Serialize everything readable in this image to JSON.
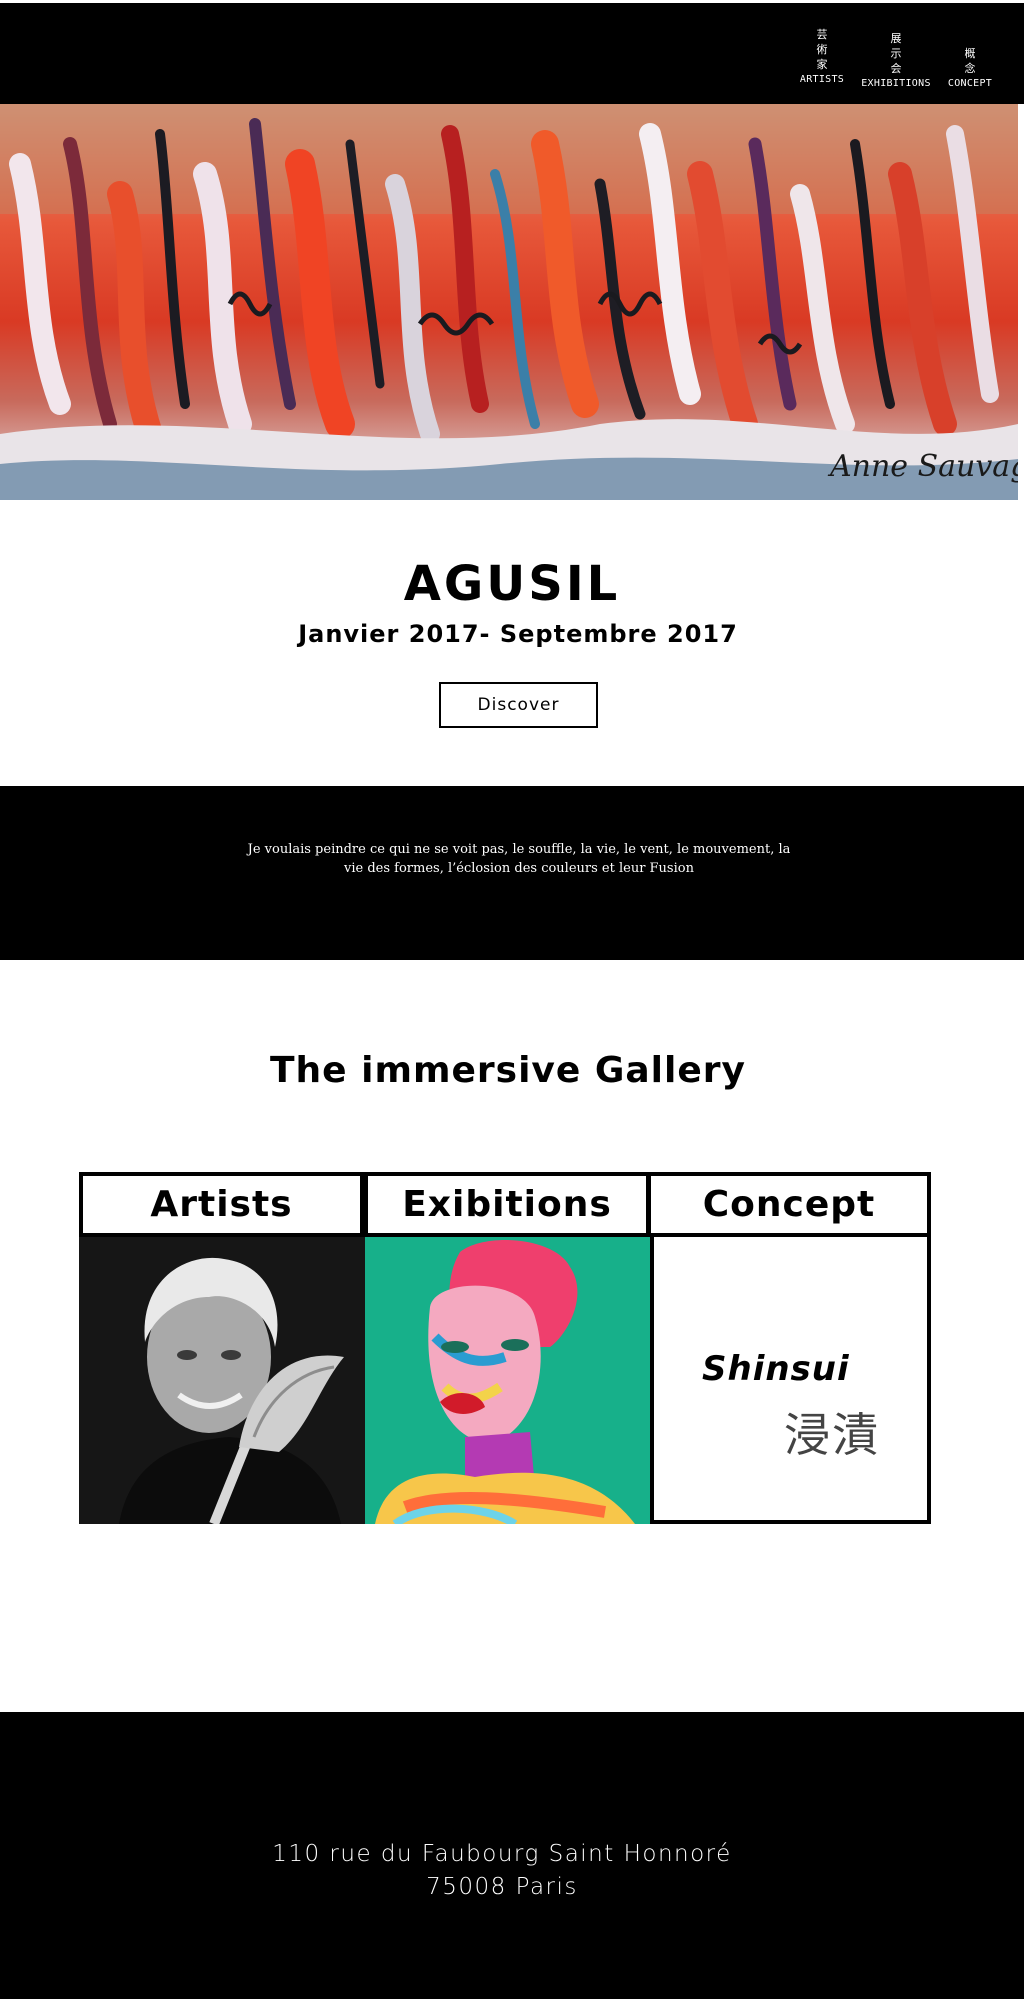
{
  "nav": {
    "items": [
      {
        "kanji": [
          "芸",
          "術",
          "家"
        ],
        "label": "ARTISTS"
      },
      {
        "kanji": [
          "展",
          "示",
          "会"
        ],
        "label": "EXHIBITIONS"
      },
      {
        "kanji": [
          "概",
          "念"
        ],
        "label": "CONCEPT"
      }
    ]
  },
  "hero": {
    "image": "abstract-painting",
    "signature": "Anne Sauvage"
  },
  "exhibition": {
    "title": "AGUSIL",
    "dates": "Janvier 2017- Septembre 2017",
    "button_label": "Discover"
  },
  "quote": {
    "line1": "Je voulais peindre ce qui ne se voit pas, le souffle, la vie, le vent, le mouvement, la",
    "line2": "vie des formes, l’éclosion des couleurs et leur Fusion"
  },
  "gallery": {
    "title": "The immersive Gallery",
    "tabs": [
      {
        "label": "Artists"
      },
      {
        "label": "Exibitions"
      },
      {
        "label": "Concept"
      }
    ],
    "concept": {
      "name": "Shinsui",
      "kanji": "浸漬"
    }
  },
  "footer": {
    "address_line1": "110 rue du Faubourg Saint Honnoré",
    "address_line2": "75008 Paris"
  },
  "colors": {
    "header_bg": "#000000",
    "band_bg": "#000000",
    "accent_red": "#e03a22",
    "teal": "#17b08a"
  }
}
